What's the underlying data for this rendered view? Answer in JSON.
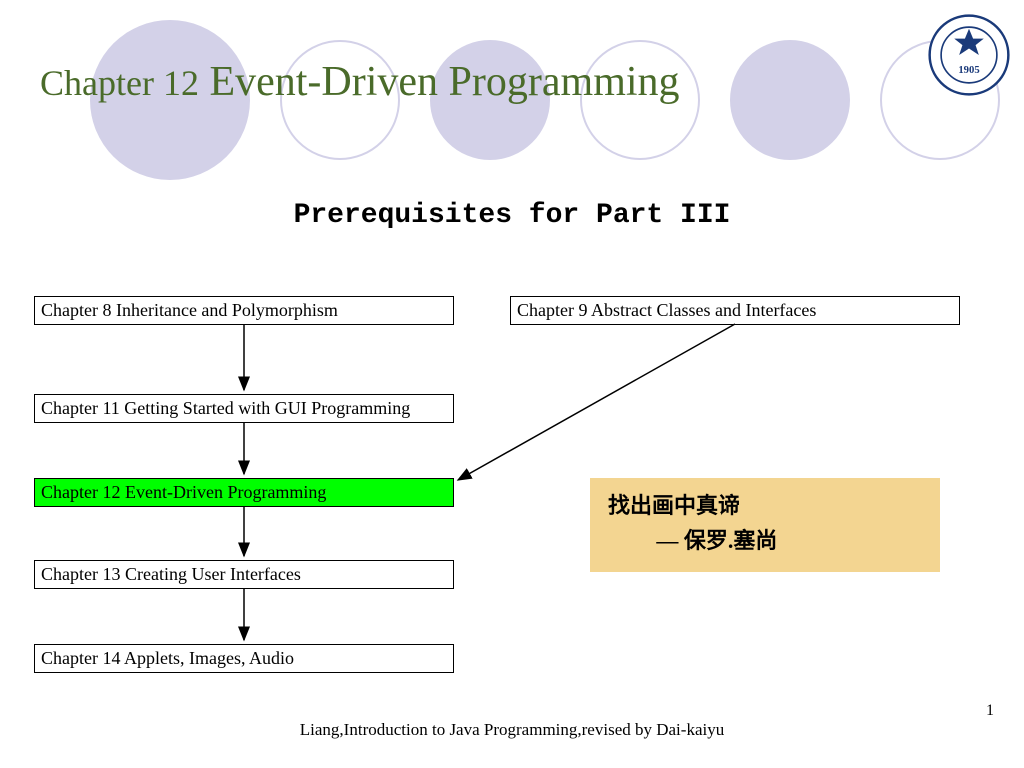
{
  "title": {
    "chapter_prefix": "Chapter 12",
    "main": " Event-Driven Programming"
  },
  "subtitle": "Prerequisites for Part III",
  "boxes": {
    "ch8": "Chapter 8 Inheritance and Polymorphism",
    "ch9": "Chapter 9 Abstract Classes and Interfaces",
    "ch11": "Chapter 11 Getting Started with GUI Programming",
    "ch12": "Chapter 12 Event-Driven Programming",
    "ch13": "Chapter 13 Creating User Interfaces",
    "ch14": "Chapter 14 Applets, Images, Audio"
  },
  "quote": {
    "line1": "找出画中真谛",
    "line2": "— 保罗.塞尚"
  },
  "footer": "Liang,Introduction to Java Programming,revised by Dai-kaiyu",
  "page_number": "1",
  "chart_data": {
    "type": "diagram",
    "nodes": [
      {
        "id": "ch8",
        "label": "Chapter 8 Inheritance and Polymorphism"
      },
      {
        "id": "ch9",
        "label": "Chapter 9 Abstract Classes and Interfaces"
      },
      {
        "id": "ch11",
        "label": "Chapter 11 Getting Started with GUI Programming"
      },
      {
        "id": "ch12",
        "label": "Chapter 12 Event-Driven Programming",
        "highlight": true
      },
      {
        "id": "ch13",
        "label": "Chapter 13 Creating User Interfaces"
      },
      {
        "id": "ch14",
        "label": "Chapter 14 Applets, Images, Audio"
      }
    ],
    "edges": [
      {
        "from": "ch8",
        "to": "ch11"
      },
      {
        "from": "ch11",
        "to": "ch12"
      },
      {
        "from": "ch9",
        "to": "ch12"
      },
      {
        "from": "ch12",
        "to": "ch13"
      },
      {
        "from": "ch13",
        "to": "ch14"
      }
    ]
  }
}
